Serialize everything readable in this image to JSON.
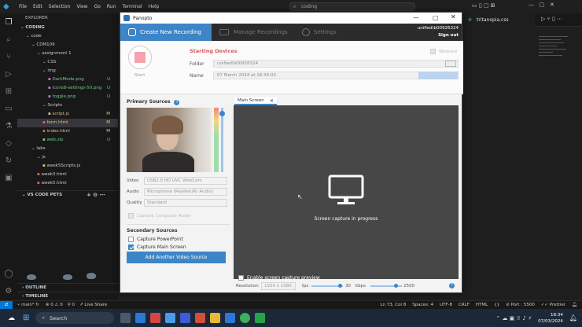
{
  "vscode": {
    "menu": [
      "File",
      "Edit",
      "Selection",
      "View",
      "Go",
      "Run",
      "Terminal",
      "Help"
    ],
    "search_text": "coding",
    "open_tab": "tritanopia.css",
    "explorer_title": "EXPLORER",
    "tree": [
      {
        "label": "CODING",
        "indent": 0,
        "kind": "root",
        "badge": ""
      },
      {
        "label": "code",
        "indent": 1,
        "kind": "folder",
        "badge": ""
      },
      {
        "label": "CDM109",
        "indent": 2,
        "kind": "folder",
        "badge": ""
      },
      {
        "label": "assignment 1",
        "indent": 3,
        "kind": "folder",
        "badge": ""
      },
      {
        "label": "CSS",
        "indent": 4,
        "kind": "folder",
        "badge": ""
      },
      {
        "label": "img",
        "indent": 4,
        "kind": "folder",
        "badge": ""
      },
      {
        "label": "DarkMode.png",
        "indent": 5,
        "kind": "file",
        "badge": "U"
      },
      {
        "label": "icons8-settings-50.png",
        "indent": 5,
        "kind": "file",
        "badge": "U"
      },
      {
        "label": "toggle.png",
        "indent": 5,
        "kind": "file",
        "badge": "U"
      },
      {
        "label": "Scripts",
        "indent": 4,
        "kind": "folder",
        "badge": ""
      },
      {
        "label": "script.js",
        "indent": 5,
        "kind": "file",
        "badge": "M"
      },
      {
        "label": "form.html",
        "indent": 4,
        "kind": "file",
        "badge": "M"
      },
      {
        "label": "index.html",
        "indent": 4,
        "kind": "file",
        "badge": "M"
      },
      {
        "label": "web.zip",
        "indent": 4,
        "kind": "file",
        "badge": "U"
      },
      {
        "label": "labs",
        "indent": 2,
        "kind": "folder",
        "badge": ""
      },
      {
        "label": "js",
        "indent": 3,
        "kind": "folder",
        "badge": ""
      },
      {
        "label": "week5Scripts.js",
        "indent": 4,
        "kind": "file",
        "badge": ""
      },
      {
        "label": "week3.html",
        "indent": 3,
        "kind": "file",
        "badge": ""
      },
      {
        "label": "week5.html",
        "indent": 3,
        "kind": "file",
        "badge": ""
      }
    ],
    "pets_header": "VS CODE PETS",
    "outline": "OUTLINE",
    "timeline": "TIMELINE",
    "status": {
      "branch": "main*",
      "errors": "0",
      "warnings": "0",
      "ports": "0",
      "live_share": "Live Share",
      "position": "Ln 73, Col 8",
      "spaces": "Spaces: 4",
      "encoding": "UTF-8",
      "eol": "CRLF",
      "language": "HTML",
      "port": "Port : 5500",
      "prettier": "Prettier"
    },
    "accent": "#0078d4"
  },
  "taskbar": {
    "search": "Search",
    "time": "18:34",
    "date": "07/03/2024"
  },
  "panopto": {
    "window_title": "Panopto",
    "tabs": {
      "create": "Create New Recording",
      "manage": "Manage Recordings",
      "settings": "Settings"
    },
    "user": {
      "name": "unified\\b00926324",
      "sign_out": "Sign out"
    },
    "record_label": "Start",
    "starting_devices": "Starting Devices",
    "folder_label": "Folder",
    "folder_value": "unified\\b00926324",
    "name_label": "Name",
    "name_value": "07 March 2024 at 18:34:02",
    "webcast_label": "Webcast",
    "primary_sources": "Primary Sources",
    "video_label": "Video",
    "video_value": "USB2.0 HD UVC WebCam",
    "audio_label": "Audio",
    "audio_value": "Microphone (Realtek(R) Audio)",
    "quality_label": "Quality",
    "quality_value": "Standard",
    "capture_audio_label": "Capture Computer Audio",
    "secondary_sources": "Secondary Sources",
    "capture_powerpoint": "Capture PowerPoint",
    "capture_main_screen": "Capture Main Screen",
    "add_video_source": "Add Another Video Source",
    "main_screen_tab": "Main Screen",
    "screen_capture_msg": "Screen capture in progress",
    "enable_preview": "Enable screen capture preview",
    "resolution_label": "Resolution",
    "resolution_value": "1920 x 1080",
    "fps_label": "fps",
    "fps_value": "30",
    "kbps_label": "kbps",
    "kbps_value": "2500",
    "accent": "#3d85c6",
    "record_color": "#f6a1ad"
  }
}
